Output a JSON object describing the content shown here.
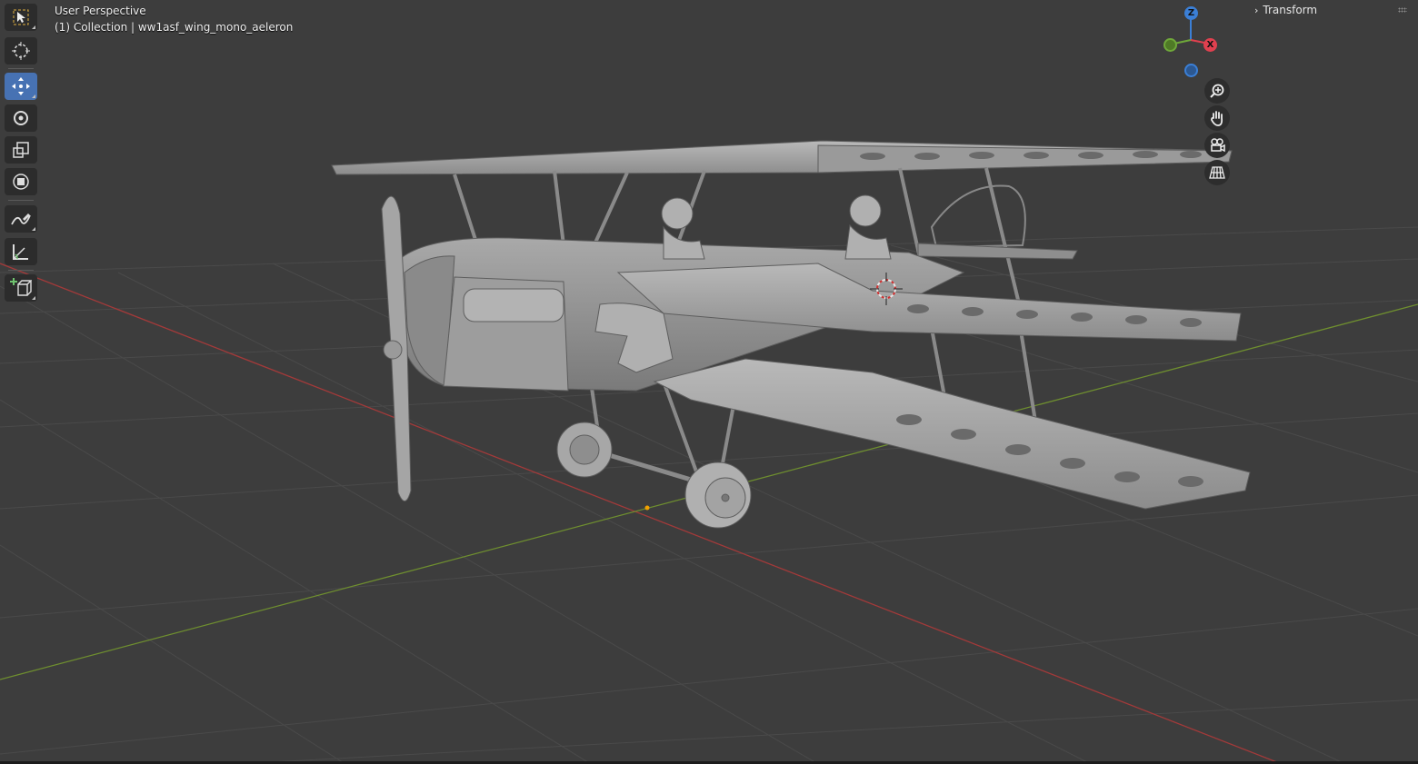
{
  "viewport": {
    "mode_label": "User Perspective",
    "collection_label": "(1) Collection | ww1asf_wing_mono_aeleron"
  },
  "toolbar": {
    "tools": [
      {
        "name": "select-box-tool",
        "icon": "select-box-icon",
        "active": false
      },
      {
        "name": "cursor-tool",
        "icon": "cursor-icon",
        "active": false
      },
      {
        "name": "move-tool",
        "icon": "move-icon",
        "active": true
      },
      {
        "name": "rotate-tool",
        "icon": "rotate-icon",
        "active": false
      },
      {
        "name": "scale-tool",
        "icon": "scale-icon",
        "active": false
      },
      {
        "name": "transform-tool",
        "icon": "transform-icon",
        "active": false
      },
      {
        "name": "annotate-tool",
        "icon": "annotate-icon",
        "active": false
      },
      {
        "name": "measure-tool",
        "icon": "measure-icon",
        "active": false
      },
      {
        "name": "add-cube-tool",
        "icon": "add-cube-icon",
        "active": false
      }
    ]
  },
  "gizmo": {
    "z_label": "Z",
    "x_label": "X",
    "colors": {
      "x": "#e0404f",
      "y": "#6fa83a",
      "z": "#3b7fd6"
    }
  },
  "nav_buttons": [
    {
      "name": "zoom-button",
      "icon": "zoom-icon"
    },
    {
      "name": "pan-button",
      "icon": "hand-icon"
    },
    {
      "name": "camera-view-button",
      "icon": "camera-icon"
    },
    {
      "name": "ortho-toggle-button",
      "icon": "grid-icon"
    }
  ],
  "sidebar": {
    "transform_label": "Transform"
  },
  "colors": {
    "background": "#3d3d3d",
    "grid": "#4a4a4a",
    "x_axis": "#a33a3a",
    "y_axis": "#6f8f2f",
    "active_tool": "#4772b3",
    "model": "#a6a6a6"
  }
}
